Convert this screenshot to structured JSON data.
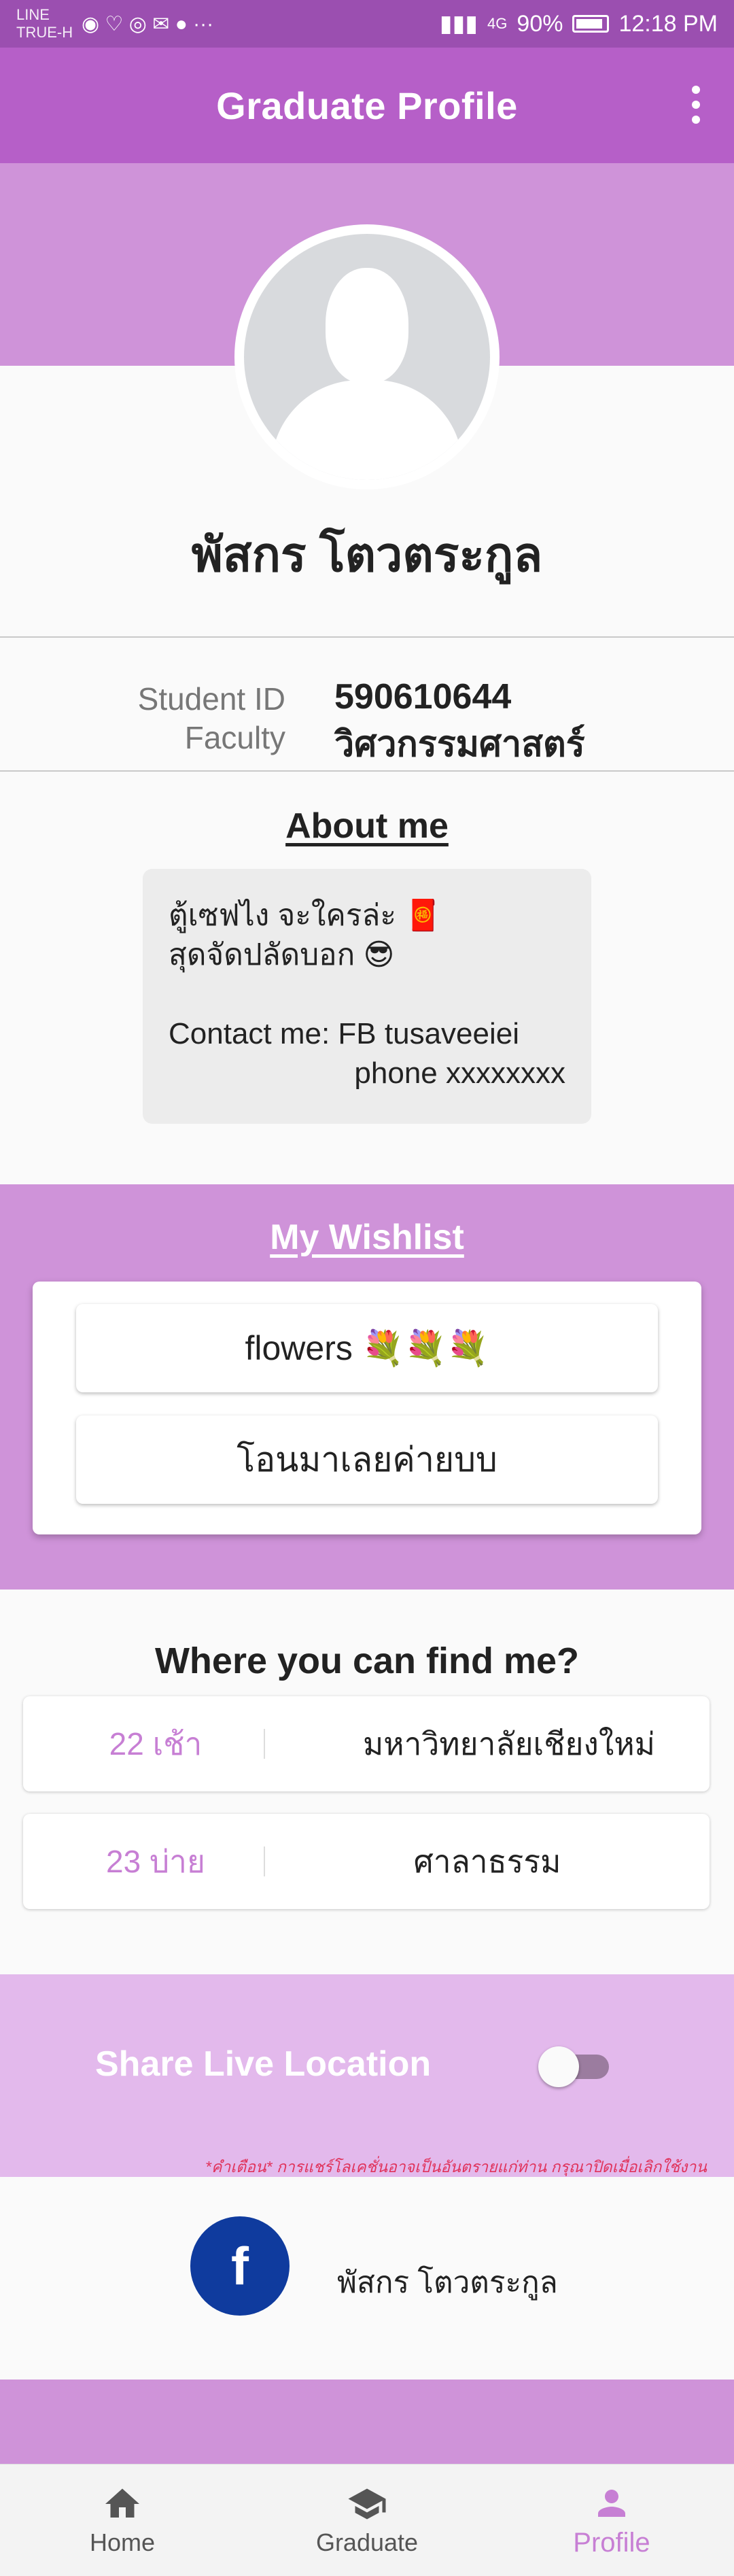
{
  "status_bar": {
    "carrier": "LINE\nTRUE-H",
    "notification_icons": "◉ ♡ ◎ ✉ ● ···",
    "network": "4G",
    "battery": "90%",
    "time": "12:18 PM"
  },
  "appbar": {
    "title": "Graduate Profile",
    "menu_icon": "more-vert-icon"
  },
  "profile": {
    "avatar_icon": "default-avatar-icon",
    "name": "พัสกร โตวตระกูล",
    "student_id_label": "Student ID",
    "student_id": "590610644",
    "faculty_label": "Faculty",
    "faculty": "วิศวกรรมศาสตร์"
  },
  "about": {
    "title": "About me",
    "line1": "ตู้เซฟไง จะใครล่ะ 🧧",
    "line2": "สุดจัดปลัดบอก 😎",
    "line3": "Contact me: FB tusaveeiei",
    "line4": "phone xxxxxxxx"
  },
  "wishlist": {
    "title": "My Wishlist",
    "items": [
      "flowers 💐💐💐",
      "โอนมาเลยค่ายบบ"
    ]
  },
  "find_me": {
    "title": "Where you can find me?",
    "rows": [
      {
        "time": "22 เช้า",
        "place": "มหาวิทยาลัยเชียงใหม่"
      },
      {
        "time": "23 บ่าย",
        "place": "ศาลาธรรม"
      }
    ]
  },
  "share": {
    "label": "Share Live Location",
    "enabled": false,
    "warning": "*คำเตือน* การแชร์โลเคชั่นอาจเป็นอันตรายแก่ท่าน กรุณาปิดเมื่อเลิกใช้งาน"
  },
  "facebook": {
    "icon": "facebook-icon",
    "letter": "f",
    "name": "พัสกร โตวตระกูล"
  },
  "bottom_nav": {
    "items": [
      {
        "label": "Home",
        "icon": "home-icon"
      },
      {
        "label": "Graduate",
        "icon": "graduation-cap-icon"
      },
      {
        "label": "Profile",
        "icon": "person-icon",
        "active": true
      }
    ]
  },
  "colors": {
    "appbar": "#b65fc8",
    "accent_band": "#cf93d9",
    "share_band": "#e3b9ec",
    "active_nav": "#c77fd4",
    "facebook": "#0f3b9e",
    "warning": "#e0335b"
  }
}
